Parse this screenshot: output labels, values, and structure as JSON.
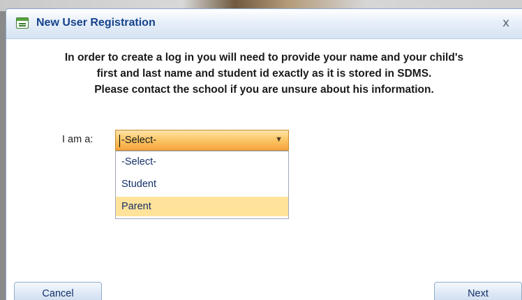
{
  "dialog": {
    "title": "New User Registration",
    "close_glyph": "x",
    "title_icon": "form-icon"
  },
  "instructions": {
    "line1": "In order to create a log in you will need to provide your name and your child's",
    "line2": "first and last name and student id exactly as it is stored in SDMS.",
    "line3": "Please contact the school if you are unsure about his information."
  },
  "role": {
    "label": "I am a:",
    "selected_value": "-Select-",
    "options": [
      "-Select-",
      "Student",
      "Parent"
    ],
    "highlighted_option": "Parent"
  },
  "footer": {
    "cancel_label": "Cancel",
    "next_label": "Next"
  },
  "colors": {
    "title_text": "#15428b",
    "select_gradient_top": "#ffe4a8",
    "select_gradient_bottom": "#f6a43c",
    "highlight": "#ffe39a",
    "dialog_border": "#8aa7cc"
  }
}
